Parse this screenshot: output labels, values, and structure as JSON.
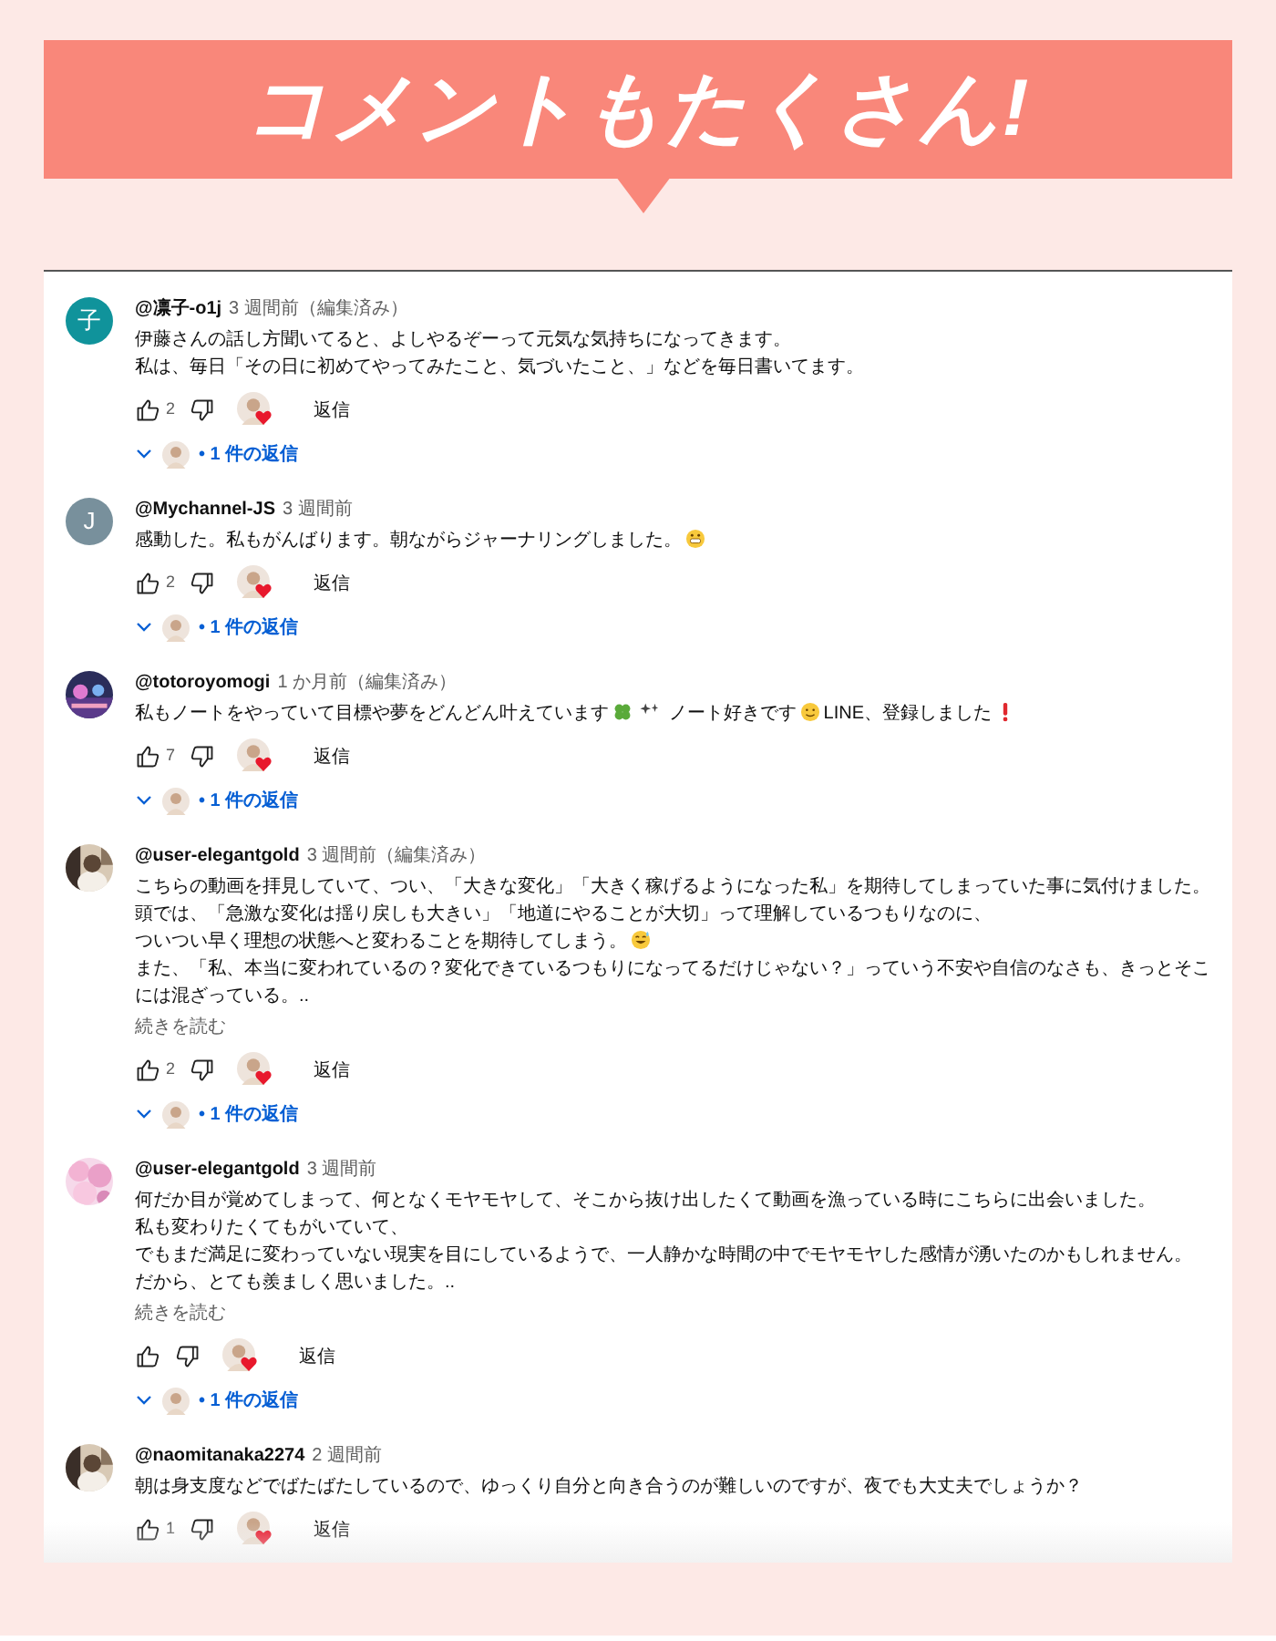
{
  "banner": {
    "title": "コメントもたくさん!"
  },
  "comments": [
    {
      "avatar": {
        "kind": "letter",
        "letter": "子",
        "color": "#10939b"
      },
      "author": "@凛子-o1j",
      "meta": "3 週間前（編集済み）",
      "lines": [
        [
          {
            "kind": "text",
            "text": "伊藤さんの話し方聞いてると、よしやるぞーって元気な気持ちになってきます。"
          }
        ],
        [
          {
            "kind": "text",
            "text": "私は、毎日「その日に初めてやってみたこと、気づいたこと、」などを毎日書いてます。"
          }
        ]
      ],
      "likes": "2",
      "reply": "返信",
      "replies": "• 1 件の返信"
    },
    {
      "avatar": {
        "kind": "letter",
        "letter": "J",
        "color": "#78909c"
      },
      "author": "@Mychannel-JS",
      "meta": "3 週間前",
      "lines": [
        [
          {
            "kind": "text",
            "text": "感動した。私もがんばります。朝ながらジャーナリングしました。"
          },
          {
            "kind": "grin"
          }
        ]
      ],
      "likes": "2",
      "reply": "返信",
      "replies": "• 1 件の返信"
    },
    {
      "avatar": {
        "kind": "picture"
      },
      "author": "@totoroyomogi",
      "meta": "1 か月前（編集済み）",
      "lines": [
        [
          {
            "kind": "text",
            "text": "私もノートをやっていて目標や夢をどんどん叶えています"
          },
          {
            "kind": "clover"
          },
          {
            "kind": "sparkle"
          },
          {
            "kind": "text",
            "text": " ノート好きです"
          },
          {
            "kind": "smile"
          },
          {
            "kind": "text",
            "text": "LINE、登録しました"
          },
          {
            "kind": "exclamation"
          }
        ]
      ],
      "likes": "7",
      "reply": "返信",
      "replies": "• 1 件の返信"
    },
    {
      "avatar": {
        "kind": "picture"
      },
      "author": "@user-elegantgold",
      "meta": "3 週間前（編集済み）",
      "lines": [
        [
          {
            "kind": "text",
            "text": "こちらの動画を拝見していて、つい、「大きな変化」「大きく稼げるようになった私」を期待してしまっていた事に気付けました。"
          }
        ],
        [
          {
            "kind": "text",
            "text": "頭では、「急激な変化は揺り戻しも大きい」「地道にやることが大切」って理解しているつもりなのに、"
          }
        ],
        [
          {
            "kind": "text",
            "text": "ついつい早く理想の状態へと変わることを期待してしまう。"
          },
          {
            "kind": "sweat"
          }
        ],
        [
          {
            "kind": "text",
            "text": "また、「私、本当に変われているの？変化できているつもりになってるだけじゃない？」っていう不安や自信のなさも、きっとそこには混ざっている。.."
          }
        ]
      ],
      "more": "続きを読む",
      "likes": "2",
      "reply": "返信",
      "replies": "• 1 件の返信"
    },
    {
      "avatar": {
        "kind": "picture"
      },
      "author": "@user-elegantgold",
      "meta": "3 週間前",
      "lines": [
        [
          {
            "kind": "text",
            "text": "何だか目が覚めてしまって、何となくモヤモヤして、そこから抜け出したくて動画を漁っている時にこちらに出会いました。"
          }
        ],
        [
          {
            "kind": "text",
            "text": "私も変わりたくてもがいていて、"
          }
        ],
        [
          {
            "kind": "text",
            "text": "でもまだ満足に変わっていない現実を目にしているようで、一人静かな時間の中でモヤモヤした感情が湧いたのかもしれません。"
          }
        ],
        [
          {
            "kind": "text",
            "text": "だから、とても羨ましく思いました。.."
          }
        ]
      ],
      "more": "続きを読む",
      "reply": "返信",
      "replies": "• 1 件の返信"
    },
    {
      "avatar": {
        "kind": "picture"
      },
      "author": "@naomitanaka2274",
      "meta": "2 週間前",
      "lines": [
        [
          {
            "kind": "text",
            "text": "朝は身支度などでばたばたしているので、ゆっくり自分と向き合うのが難しいのですが、夜でも大丈夫でしょうか？"
          }
        ]
      ],
      "likes": "1",
      "reply": "返信"
    }
  ]
}
